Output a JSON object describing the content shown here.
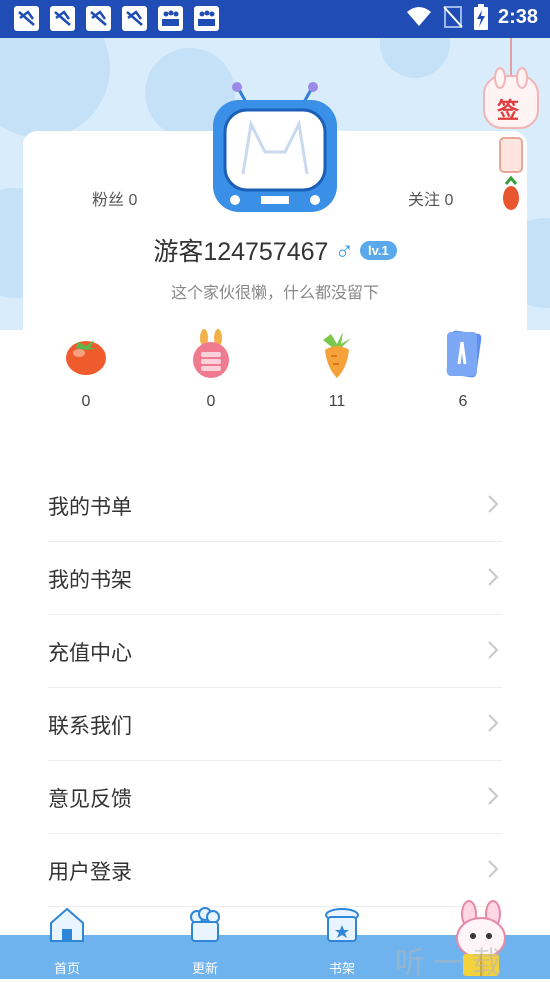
{
  "status_bar": {
    "time": "2:38",
    "notification_icons": [
      "notification-app-icon",
      "notification-app-icon",
      "notification-app-icon",
      "notification-app-icon",
      "photo-icon",
      "photo-icon"
    ],
    "system_icons": [
      "wifi-icon",
      "no-signal-icon",
      "battery-charging-icon"
    ]
  },
  "profile": {
    "fans_label": "粉丝 0",
    "follow_label": "关注 0",
    "username": "游客124757467",
    "gender_symbol": "♂",
    "level": "lv.1",
    "bio": "这个家伙很懒，什么都没留下",
    "sign_label": "签"
  },
  "stats": [
    {
      "icon": "tomato-icon",
      "value": "0"
    },
    {
      "icon": "coin-rabbit-icon",
      "value": "0"
    },
    {
      "icon": "carrot-icon",
      "value": "11"
    },
    {
      "icon": "card-icon",
      "value": "6"
    }
  ],
  "menu": [
    {
      "label": "我的书单"
    },
    {
      "label": "我的书架"
    },
    {
      "label": "充值中心"
    },
    {
      "label": "联系我们"
    },
    {
      "label": "意见反馈"
    },
    {
      "label": "用户登录"
    }
  ],
  "bottom_nav": [
    {
      "label": "首页",
      "icon": "home-icon"
    },
    {
      "label": "更新",
      "icon": "update-icon"
    },
    {
      "label": "书架",
      "icon": "bookshelf-icon"
    }
  ],
  "watermark": "听 一 载",
  "colors": {
    "status_bar": "#1f4db5",
    "header_bg": "#d8ecfb",
    "accent": "#5aa9ec",
    "nav_bg": "#6fb3ee"
  }
}
